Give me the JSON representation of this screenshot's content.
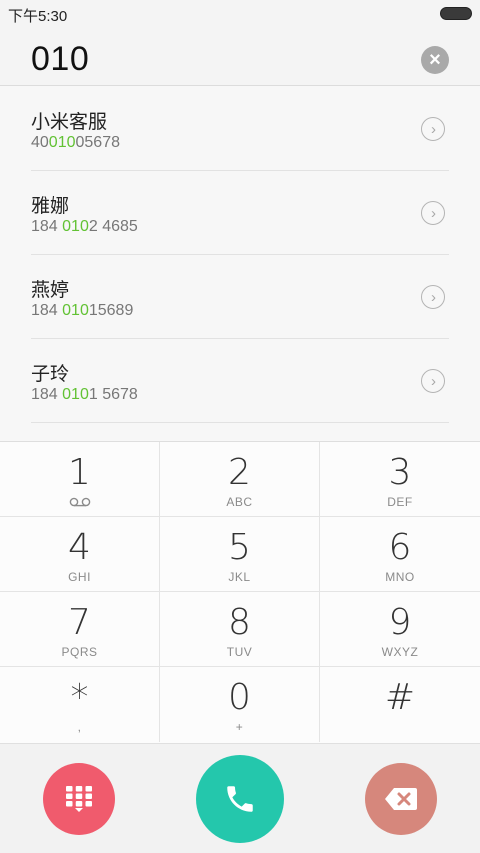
{
  "status": {
    "time": "下午5:30"
  },
  "entry": {
    "number": "010"
  },
  "results": [
    {
      "name": "小米客服",
      "pre": "40",
      "hl": "010",
      "post": "05678"
    },
    {
      "name": "雅娜",
      "pre": "184 ",
      "hl": "010",
      "post": "2 4685"
    },
    {
      "name": "燕婷",
      "pre": "184 ",
      "hl": "010",
      "post": "15689"
    },
    {
      "name": "子玲",
      "pre": "184 ",
      "hl": "010",
      "post": "1 5678"
    }
  ],
  "keys": [
    {
      "digit": "1",
      "letters": ""
    },
    {
      "digit": "2",
      "letters": "ABC"
    },
    {
      "digit": "3",
      "letters": "DEF"
    },
    {
      "digit": "4",
      "letters": "GHI"
    },
    {
      "digit": "5",
      "letters": "JKL"
    },
    {
      "digit": "6",
      "letters": "MNO"
    },
    {
      "digit": "7",
      "letters": "PQRS"
    },
    {
      "digit": "8",
      "letters": "TUV"
    },
    {
      "digit": "9",
      "letters": "WXYZ"
    },
    {
      "digit": "*",
      "letters": ","
    },
    {
      "digit": "0",
      "letters": "+"
    },
    {
      "digit": "#",
      "letters": ""
    }
  ],
  "icons": {
    "voicemail": "voicemail-icon",
    "dialpad": "dialpad-grid-icon",
    "call": "phone-icon",
    "delete": "backspace-icon",
    "clear": "close-icon",
    "arrow": "chevron-right-icon"
  },
  "colors": {
    "highlight": "#62c234",
    "dialpad_button": "#f05b6d",
    "call_button": "#24c7ac",
    "delete_button": "#d6877c"
  }
}
